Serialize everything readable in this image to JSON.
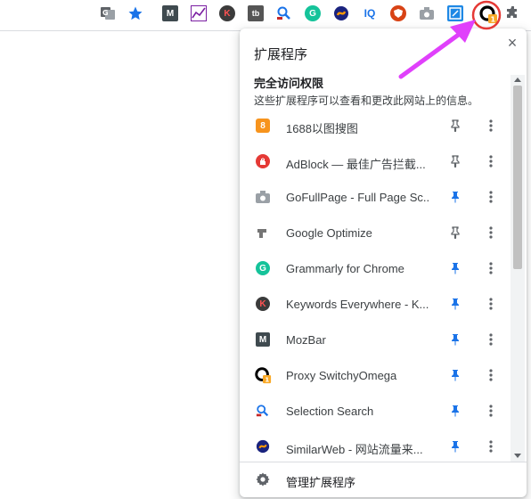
{
  "toolbar": {
    "icons": [
      {
        "name": "translate-icon"
      },
      {
        "name": "bookmark-star-icon"
      },
      {
        "name": "mozbar-icon",
        "text": "M"
      },
      {
        "name": "chart-extension-icon"
      },
      {
        "name": "keywords-everywhere-icon",
        "text": "K"
      },
      {
        "name": "tb-extension-icon",
        "text": "tb"
      },
      {
        "name": "selection-search-icon"
      },
      {
        "name": "grammarly-icon"
      },
      {
        "name": "similarweb-icon"
      },
      {
        "name": "iq-extension-icon",
        "text": "IQ"
      },
      {
        "name": "adblock-shield-icon"
      },
      {
        "name": "gofullpage-camera-icon"
      },
      {
        "name": "seo-extension-icon"
      },
      {
        "name": "proxy-switchyomega-icon",
        "badge": "1"
      },
      {
        "name": "extensions-puzzle-icon"
      }
    ]
  },
  "popup": {
    "title": "扩展程序",
    "close_icon": "×",
    "section_title": "完全访问权限",
    "section_subtitle": "这些扩展程序可以查看和更改此网站上的信息。",
    "items": [
      {
        "name": "1688以图搜图",
        "icon_text": "8",
        "icon_color": "#f7941d",
        "pinned": false
      },
      {
        "name": "AdBlock — 最佳广告拦截...",
        "icon_text": "✋",
        "icon_color": "#e53935",
        "pinned": false
      },
      {
        "name": "GoFullPage - Full Page Sc...",
        "icon_text": "",
        "icon_color": "#9aa0a6",
        "pinned": true
      },
      {
        "name": "Google Optimize",
        "icon_text": "",
        "icon_color": "#757575",
        "pinned": false
      },
      {
        "name": "Grammarly for Chrome",
        "icon_text": "G",
        "icon_color": "#15c39a",
        "pinned": true
      },
      {
        "name": "Keywords Everywhere - K...",
        "icon_text": "K",
        "icon_color": "#3b3b3b",
        "pinned": true
      },
      {
        "name": "MozBar",
        "icon_text": "M",
        "icon_color": "#3f4a4f",
        "pinned": true
      },
      {
        "name": "Proxy SwitchyOmega",
        "icon_text": "",
        "icon_color": "#000000",
        "pinned": true,
        "badge": "1"
      },
      {
        "name": "Selection Search",
        "icon_text": "",
        "icon_color": "#1a73e8",
        "pinned": true
      },
      {
        "name": "SimilarWeb - 网站流量来...",
        "icon_text": "",
        "icon_color": "#1a237e",
        "pinned": true
      }
    ],
    "footer_label": "管理扩展程序"
  },
  "colors": {
    "pin_active": "#1a73e8",
    "pin_inactive": "#5f6368",
    "annotation_arrow": "#e040fb",
    "annotation_circle": "#e53935"
  }
}
